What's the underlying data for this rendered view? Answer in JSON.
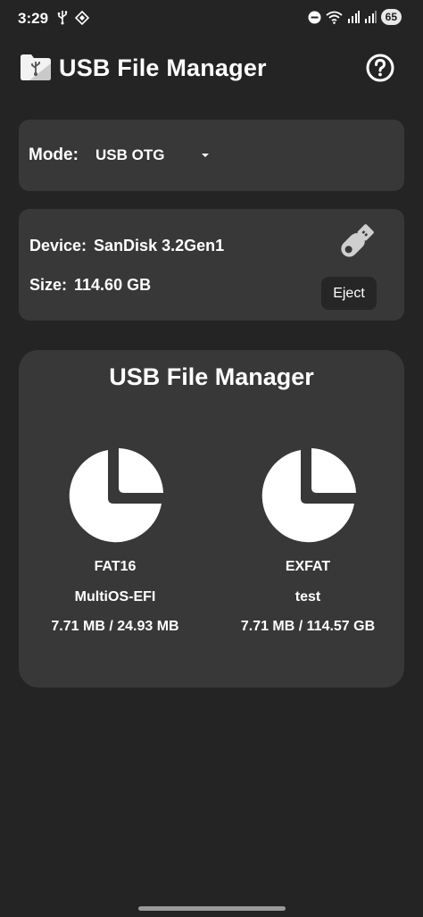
{
  "status_bar": {
    "time": "3:29",
    "left_icons": [
      "usb-icon",
      "vpn-icon"
    ],
    "right_icons": [
      "do-not-disturb-icon",
      "wifi-icon",
      "signal-icon",
      "signal-icon"
    ],
    "battery": "65"
  },
  "app_bar": {
    "title": "USB File Manager",
    "logo_icon": "usb-folder-icon",
    "help_icon": "help-icon"
  },
  "mode": {
    "label": "Mode:",
    "selected": "USB OTG"
  },
  "device": {
    "name_label": "Device:",
    "name_value": "SanDisk 3.2Gen1",
    "size_label": "Size:",
    "size_value": "114.60 GB",
    "icon": "usb-drive-icon",
    "eject_label": "Eject"
  },
  "volumes": {
    "title": "USB File Manager",
    "items": [
      {
        "filesystem": "FAT16",
        "label": "MultiOS-EFI",
        "usage": "7.71 MB / 24.93 MB",
        "icon": "pie-chart-icon"
      },
      {
        "filesystem": "EXFAT",
        "label": "test",
        "usage": "7.71 MB / 114.57 GB",
        "icon": "pie-chart-icon"
      }
    ]
  },
  "colors": {
    "background": "#242424",
    "card": "#383838",
    "button": "#262626",
    "text": "#ffffff"
  }
}
